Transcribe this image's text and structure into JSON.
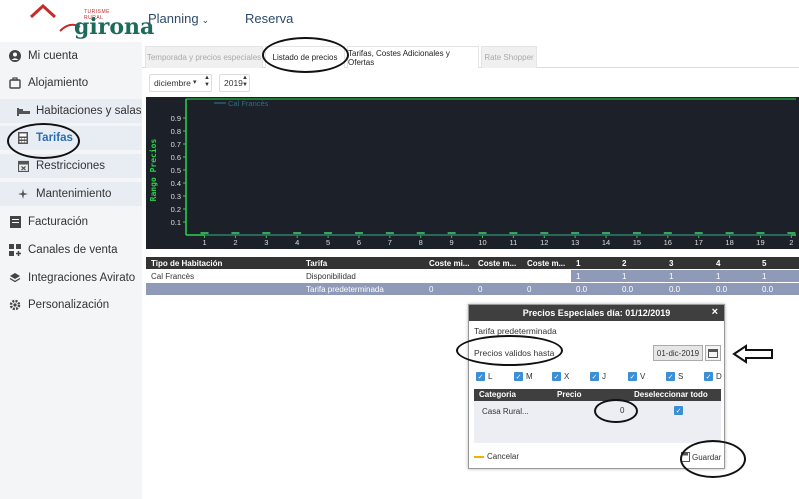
{
  "header": {
    "logo_tagline": "TURISME RURAL",
    "logo_name": "girona",
    "nav": [
      {
        "label": "Planning"
      },
      {
        "label": "Reserva"
      }
    ]
  },
  "sidebar": {
    "items": [
      {
        "label": "Mi cuenta",
        "icon": "user-circle-icon"
      },
      {
        "label": "Alojamiento",
        "icon": "suitcase-icon"
      },
      {
        "label": "Habitaciones y salas",
        "icon": "bed-icon"
      },
      {
        "label": "Tarifas",
        "icon": "calculator-icon"
      },
      {
        "label": "Restricciones",
        "icon": "calendar-x-icon"
      },
      {
        "label": "Mantenimiento",
        "icon": "sparkle-icon"
      },
      {
        "label": "Facturación",
        "icon": "invoice-icon"
      },
      {
        "label": "Canales de venta",
        "icon": "grid-plus-icon"
      },
      {
        "label": "Integraciones Avirato",
        "icon": "layers-icon"
      },
      {
        "label": "Personalización",
        "icon": "gear-icon"
      }
    ]
  },
  "tabs": [
    {
      "label": "Temporada y precios especiales"
    },
    {
      "label": "Listado de precios"
    },
    {
      "label": "Tarifas, Costes Adicionales y Ofertas"
    },
    {
      "label": "Rate Shopper"
    }
  ],
  "filters": {
    "month": "diciembre",
    "year": "2019"
  },
  "chart_data": {
    "type": "line",
    "ylabel": "Rango Precios",
    "yticks": [
      "0.1",
      "0.2",
      "0.3",
      "0.4",
      "0.5",
      "0.6",
      "0.7",
      "0.8",
      "0.9"
    ],
    "ylim": [
      0,
      1
    ],
    "x": [
      "1",
      "2",
      "3",
      "4",
      "5",
      "6",
      "7",
      "8",
      "9",
      "10",
      "11",
      "12",
      "13",
      "14",
      "15",
      "16",
      "17",
      "18",
      "19",
      "2"
    ],
    "series": [
      {
        "name": "Cal Francès",
        "values": [
          0,
          0,
          0,
          0,
          0,
          0,
          0,
          0,
          0,
          0,
          0,
          0,
          0,
          0,
          0,
          0,
          0,
          0,
          0,
          0
        ]
      }
    ],
    "colors": {
      "background": "#1c2028",
      "axis": "#27d34a",
      "series": "#2c5e6e"
    }
  },
  "table": {
    "headers": [
      "Tipo de Habitación",
      "Tarifa",
      "Coste mi...",
      "Coste m...",
      "Coste m...",
      "1",
      "2",
      "3",
      "4",
      "5"
    ],
    "rows": [
      {
        "cells": [
          "Cal Francès",
          "Disponibilidad",
          "",
          "",
          "",
          "1",
          "1",
          "1",
          "1",
          "1"
        ]
      },
      {
        "cells": [
          "",
          "Tarifa predeterminada",
          "0",
          "0",
          "0",
          "0.0",
          "0.0",
          "0.0",
          "0.0",
          "0.0"
        ]
      }
    ]
  },
  "modal": {
    "title": "Precios Especiales día: 01/12/2019",
    "close": "×",
    "tarifa_label": "Tarifa predeterminada",
    "valid_label": "Precios validos hasta",
    "date_value": "01-dic-2019",
    "days": [
      "L",
      "M",
      "X",
      "J",
      "V",
      "S",
      "D"
    ],
    "table_headers": [
      "Categoria",
      "Precio",
      "Deseleccionar todo"
    ],
    "row": {
      "category": "Casa Rural...",
      "price": "0"
    },
    "cancel_label": "Cancelar",
    "save_label": "Guardar"
  },
  "colors": {
    "accent": "#2c6db3",
    "checkbox": "#3b8fd6",
    "table_header": "#333333",
    "highlight_row": "#8e9ab8"
  }
}
